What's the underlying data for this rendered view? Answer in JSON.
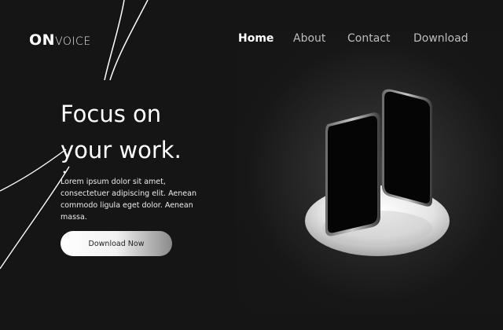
{
  "brand": {
    "strong": "ON",
    "light": "VOICE"
  },
  "nav": {
    "items": [
      {
        "label": "Home",
        "active": true
      },
      {
        "label": "About",
        "active": false
      },
      {
        "label": "Contact",
        "active": false
      },
      {
        "label": "Download",
        "active": false
      }
    ]
  },
  "hero": {
    "title_line1": "Focus on",
    "title_line2": "your work.",
    "body": "Lorem ipsum dolor sit amet, consectetuer adipiscing elit. Aenean commodo ligula eget dolor. Aenean massa.",
    "cta_label": "Download Now"
  },
  "colors": {
    "background": "#151515",
    "text": "#ffffff",
    "nav_inactive": "#bdbdbd"
  }
}
